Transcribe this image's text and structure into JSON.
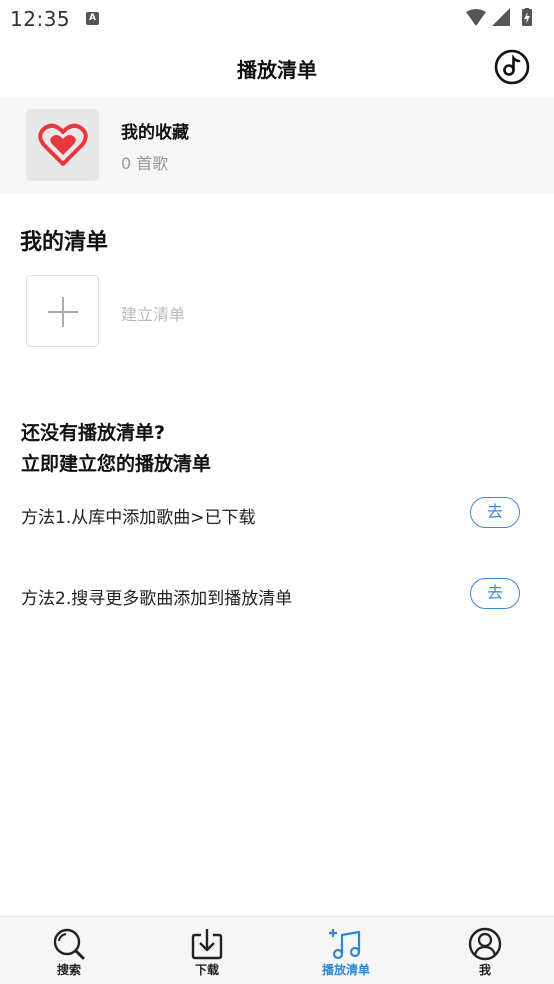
{
  "status_bar": {
    "time": "12:35",
    "notification_icon": "a-badge-icon",
    "icons": [
      "wifi-icon",
      "signal-icon",
      "battery-charging-icon"
    ]
  },
  "header": {
    "title": "播放清单",
    "right_icon": "music-disc-icon"
  },
  "favorites": {
    "title": "我的收藏",
    "count": "0 首歌",
    "icon": "heart-icon",
    "icon_color": "#e8383d"
  },
  "my_lists": {
    "title": "我的清单",
    "create_label": "建立清单",
    "create_icon": "plus-icon"
  },
  "empty_state": {
    "line1": "还没有播放清单?",
    "line2": "立即建立您的播放清单",
    "methods": [
      {
        "text": "方法1.从库中添加歌曲>已下载",
        "button": "去"
      },
      {
        "text": "方法2.搜寻更多歌曲添加到播放清单",
        "button": "去"
      }
    ]
  },
  "tabbar": {
    "active_color": "#2f86d8",
    "tabs": [
      {
        "label": "搜索",
        "icon": "search-icon",
        "active": false
      },
      {
        "label": "下载",
        "icon": "download-icon",
        "active": false
      },
      {
        "label": "播放清单",
        "icon": "playlist-add-icon",
        "active": true
      },
      {
        "label": "我",
        "icon": "user-icon",
        "active": false
      }
    ]
  }
}
